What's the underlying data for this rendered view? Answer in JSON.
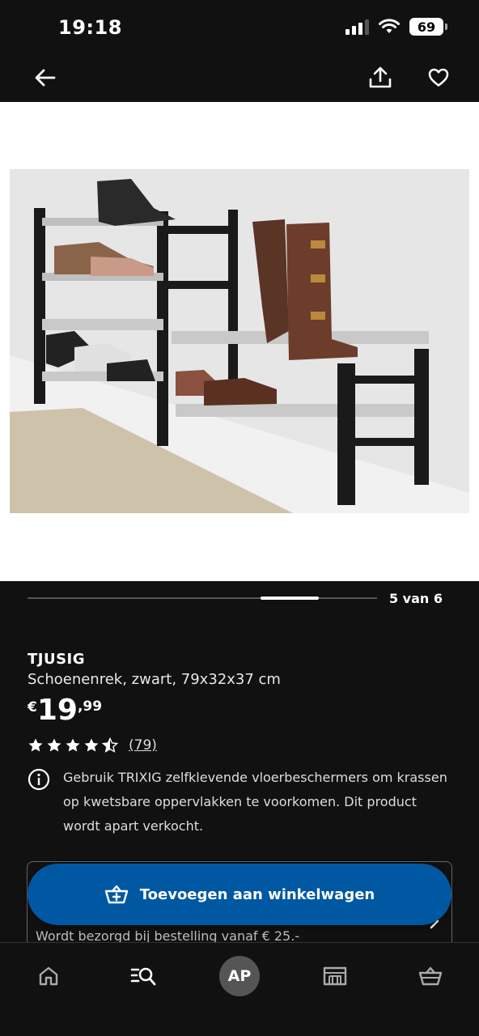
{
  "status_bar": {
    "time": "19:18",
    "battery": "69"
  },
  "top_nav": {
    "back_icon": "arrow-left-icon",
    "share_icon": "share-icon",
    "favorite_icon": "heart-icon"
  },
  "gallery": {
    "counter": "5 van 6",
    "current": 5,
    "total": 6
  },
  "product": {
    "brand": "TJUSIG",
    "description": "Schoenenrek, zwart, 79x32x37 cm",
    "price": {
      "currency": "€",
      "integer": "19",
      "decimal": ",99"
    },
    "rating": {
      "stars": 4.5,
      "max": 5,
      "count": "(79)"
    }
  },
  "info_notice": {
    "text": "Gebruik TRIXIG zelfklevende vloerbeschermers om krassen op kwetsbare oppervlakken te voorkomen. Dit product wordt apart verkocht."
  },
  "cart_button": {
    "label": "Toevoegen aan winkelwagen"
  },
  "delivery": {
    "text": "Wordt bezorgd bij bestelling vanaf € 25.-"
  },
  "bottom_nav": {
    "avatar_initials": "AP",
    "tabs": [
      "home-icon",
      "search-list-icon",
      "avatar",
      "store-icon",
      "basket-icon"
    ]
  },
  "colors": {
    "background": "#111111",
    "accent_blue": "#0058a3",
    "text": "#ffffff"
  }
}
